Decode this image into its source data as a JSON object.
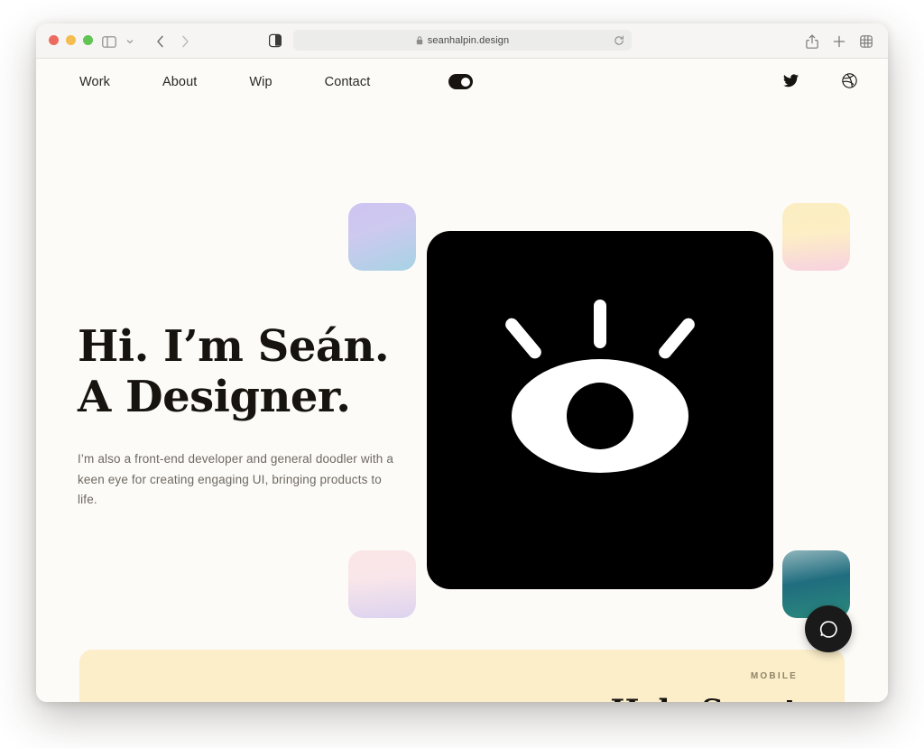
{
  "browser": {
    "traffic_lights": [
      "close",
      "minimize",
      "maximize"
    ],
    "sidebar_icon": "sidebar-icon",
    "chevron_icon": "chevron-down-icon",
    "back_icon": "back-arrow-icon",
    "forward_icon": "forward-arrow-icon",
    "reader_icon": "reader-view-icon",
    "url": "seanhalpin.design",
    "lock_icon": "lock-icon",
    "reload_icon": "reload-icon",
    "share_icon": "share-icon",
    "new_tab_icon": "plus-icon",
    "tab_overview_icon": "tab-overview-icon"
  },
  "site": {
    "nav": {
      "links": [
        {
          "label": "Work"
        },
        {
          "label": "About"
        },
        {
          "label": "Wip"
        },
        {
          "label": "Contact"
        }
      ],
      "theme_toggle": {
        "name": "dark-mode-toggle",
        "state": "on"
      },
      "social": [
        {
          "name": "twitter-icon",
          "label": "Twitter"
        },
        {
          "name": "dribbble-icon",
          "label": "Dribbble"
        }
      ]
    },
    "hero": {
      "title_line1": "Hi. I’m Seán.",
      "title_line2": "A Designer.",
      "subtitle": "I’m also a front-end developer and general doodler with a keen eye for creating engaging UI, bringing products to life.",
      "logo_card": {
        "name": "eye-logo-card",
        "color": "#000000"
      },
      "decorations": [
        {
          "name": "gradient-square-top-left",
          "from": "#cfc5f2",
          "to": "#a7d3e4"
        },
        {
          "name": "gradient-square-top-right",
          "from": "#fceec2",
          "to": "#f7d2e0"
        },
        {
          "name": "gradient-square-bottom-left",
          "from": "#fbe6e6",
          "to": "#ddd3ef"
        },
        {
          "name": "gradient-square-bottom-right",
          "from": "#1d5a78",
          "to": "#2b8a7c"
        }
      ]
    },
    "project_card": {
      "kicker": "MOBILE",
      "title": "Help Scout",
      "background": "#fbeec9"
    },
    "help_widget": {
      "name": "help-chat-button",
      "icon": "chat-bubble-icon"
    }
  },
  "theme": {
    "page_background": "#fdfbf7",
    "text_color": "#17130f",
    "muted_text": "#6e6862"
  }
}
